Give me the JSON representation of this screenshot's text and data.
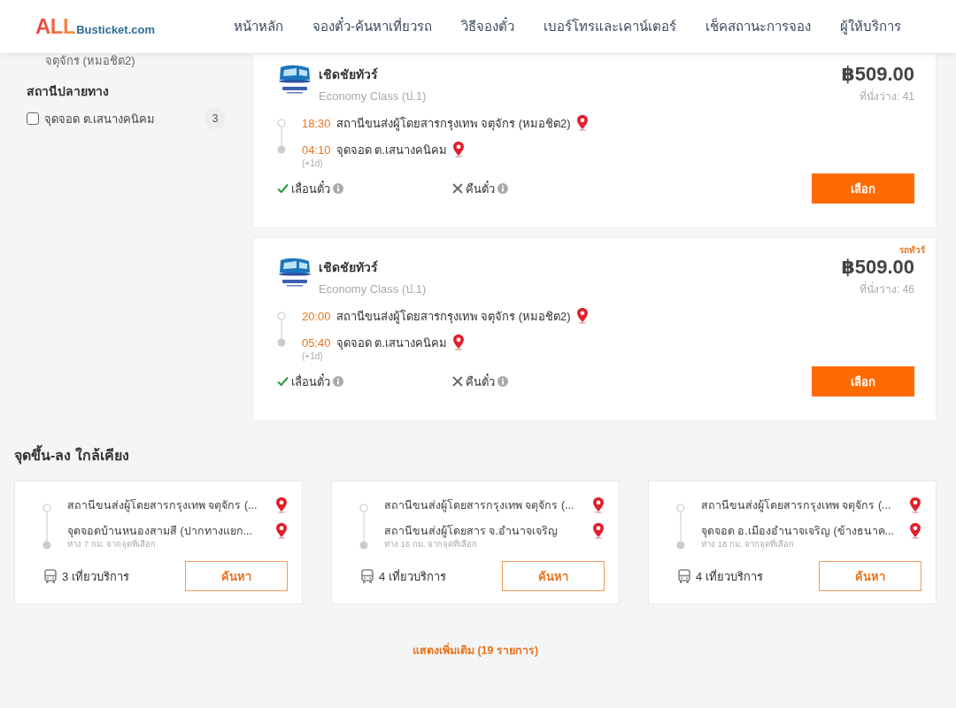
{
  "header": {
    "logo": {
      "accent": "ALL",
      "rest": "Busticket.com"
    },
    "nav": [
      "หน้าหลัก",
      "จองตั๋ว-ค้นหาเที่ยวรถ",
      "วิธีจองตั๋ว",
      "เบอร์โทรและเคาน์เตอร์",
      "เช็คสถานะการจอง",
      "ผู้ให้บริการ"
    ]
  },
  "sidebar": {
    "cut_text": "จตุจักร (หมอชิต2)",
    "sections": [
      {
        "title": "สถานีปลายทาง",
        "options": [
          {
            "label": "จุดจอด ต.เสนางคนิคม",
            "count": "3",
            "checked": false
          }
        ]
      }
    ]
  },
  "trips": [
    {
      "operator": "เชิดชัยทัวร์",
      "class": "Economy Class (ป.1)",
      "price": "฿509.00",
      "seats": "ที่นั่งว่าง: 41",
      "depart": {
        "time": "18:30",
        "place": "สถานีขนส่งผู้โดยสารกรุงเทพ จตุจักร (หมอชิต2)"
      },
      "arrive": {
        "time": "04:10",
        "place": "จุดจอด ต.เสนางคนิคม",
        "day_offset": "(+1d)"
      },
      "policies": [
        {
          "label": "เลื่อนตั๋ว",
          "allowed": true
        },
        {
          "label": "คืนตั๋ว",
          "allowed": false
        }
      ],
      "button": "เลือก"
    },
    {
      "tag": "รถทัวร์",
      "operator": "เชิดชัยทัวร์",
      "class": "Economy Class (ป.1)",
      "price": "฿509.00",
      "seats": "ที่นั่งว่าง: 46",
      "depart": {
        "time": "20:00",
        "place": "สถานีขนส่งผู้โดยสารกรุงเทพ จตุจักร (หมอชิต2)"
      },
      "arrive": {
        "time": "05:40",
        "place": "จุดจอด ต.เสนางคนิคม",
        "day_offset": "(+1d)"
      },
      "policies": [
        {
          "label": "เลื่อนตั๋ว",
          "allowed": true
        },
        {
          "label": "คืนตั๋ว",
          "allowed": false
        }
      ],
      "button": "เลือก"
    }
  ],
  "nearby": {
    "title": "จุดขึ้น-ลง ใกล้เคียง",
    "cards": [
      {
        "from": "สถานีขนส่งผู้โดยสารกรุงเทพ จตุจักร (...",
        "to": "จุดจอดบ้านหนองสามสี (ปากทางแยก...",
        "distance": "ห่าง 7 กม. จากจุดที่เลือก",
        "trips": "3 เที่ยวบริการ",
        "button": "ค้นหา"
      },
      {
        "from": "สถานีขนส่งผู้โดยสารกรุงเทพ จตุจักร (...",
        "to": "สถานีขนส่งผู้โดยสาร จ.อำนาจเจริญ",
        "distance": "ห่าง 16 กม. จากจุดที่เลือก",
        "trips": "4 เที่ยวบริการ",
        "button": "ค้นหา"
      },
      {
        "from": "สถานีขนส่งผู้โดยสารกรุงเทพ จตุจักร (...",
        "to": "จุดจอด อ.เมืองอำนาจเจริญ (ข้างธนาค...",
        "distance": "ห่าง 18 กม. จากจุดที่เลือก",
        "trips": "4 เที่ยวบริการ",
        "button": "ค้นหา"
      }
    ]
  },
  "show_more": "แสดงเพิ่มเติม (19 รายการ)"
}
